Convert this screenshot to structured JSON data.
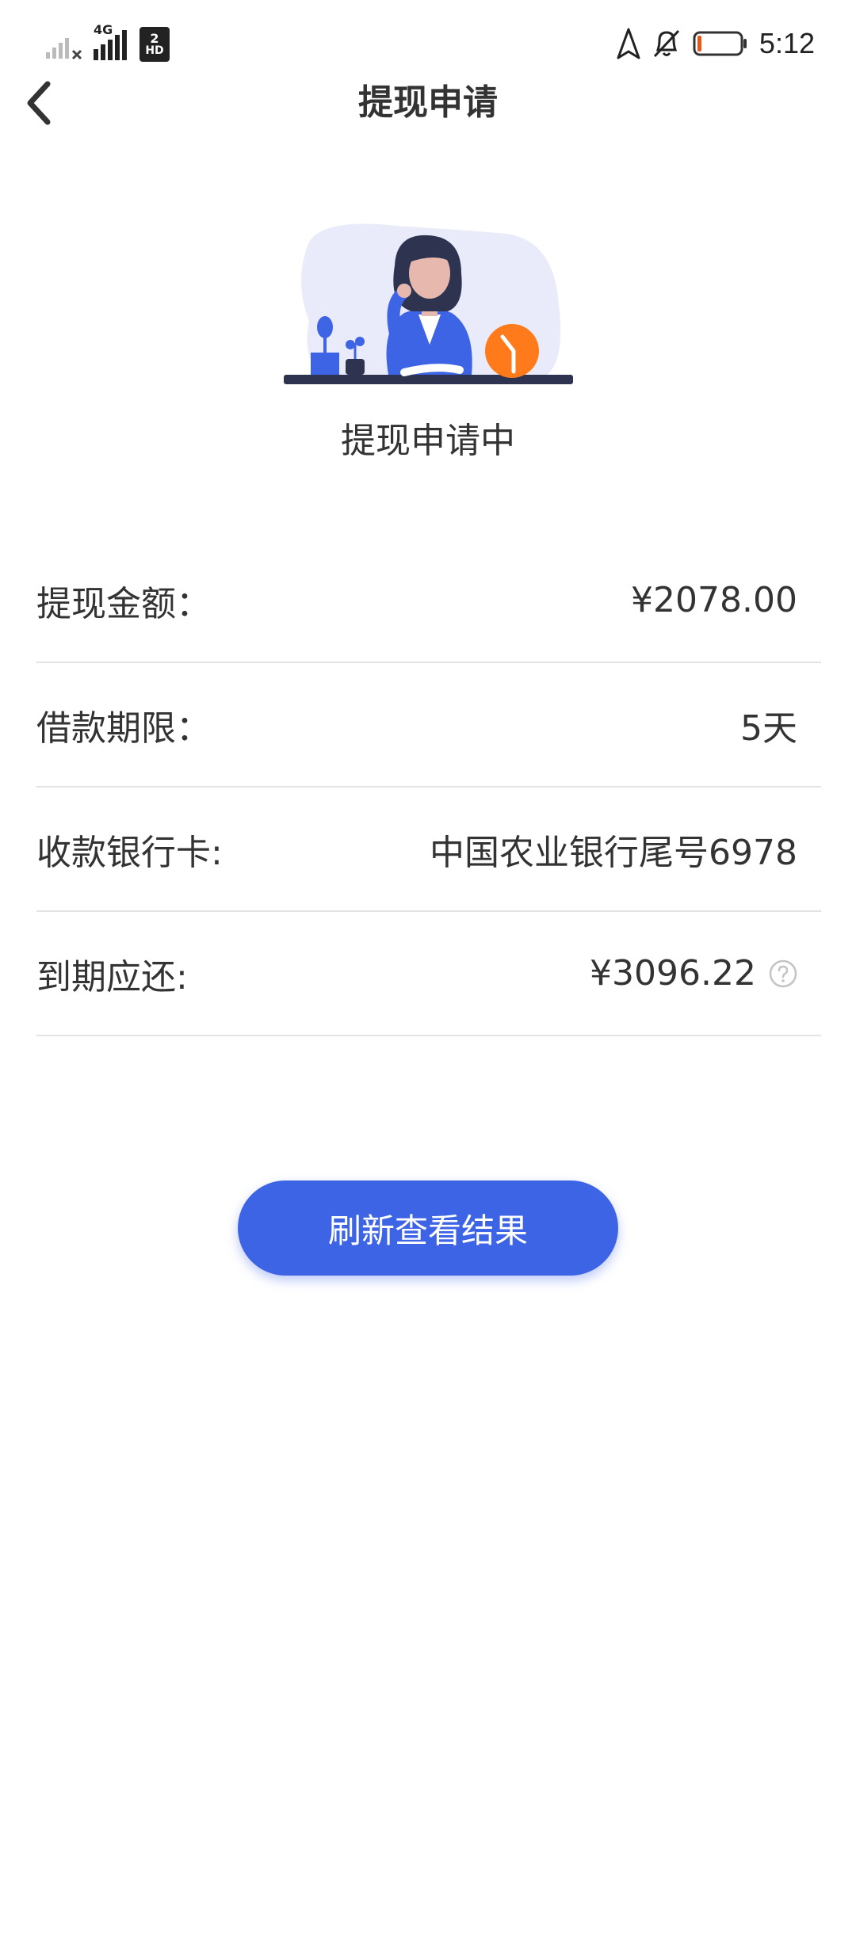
{
  "status_bar": {
    "network_label": "4G",
    "sim_label": "2",
    "hd_label": "HD",
    "time": "5:12"
  },
  "nav": {
    "title": "提现申请"
  },
  "status": {
    "text": "提现申请中"
  },
  "info": {
    "rows": [
      {
        "label": "提现金额：",
        "value": "¥2078.00"
      },
      {
        "label": "借款期限：",
        "value": "5天"
      },
      {
        "label": "收款银行卡:",
        "value": "中国农业银行尾号6978"
      },
      {
        "label": "到期应还:",
        "value": "¥3096.22"
      }
    ]
  },
  "button": {
    "refresh_label": "刷新查看结果"
  },
  "colors": {
    "accent": "#3e64e6",
    "clock_orange": "#ff7a1a",
    "illustration_bg": "#e9ebfb"
  }
}
